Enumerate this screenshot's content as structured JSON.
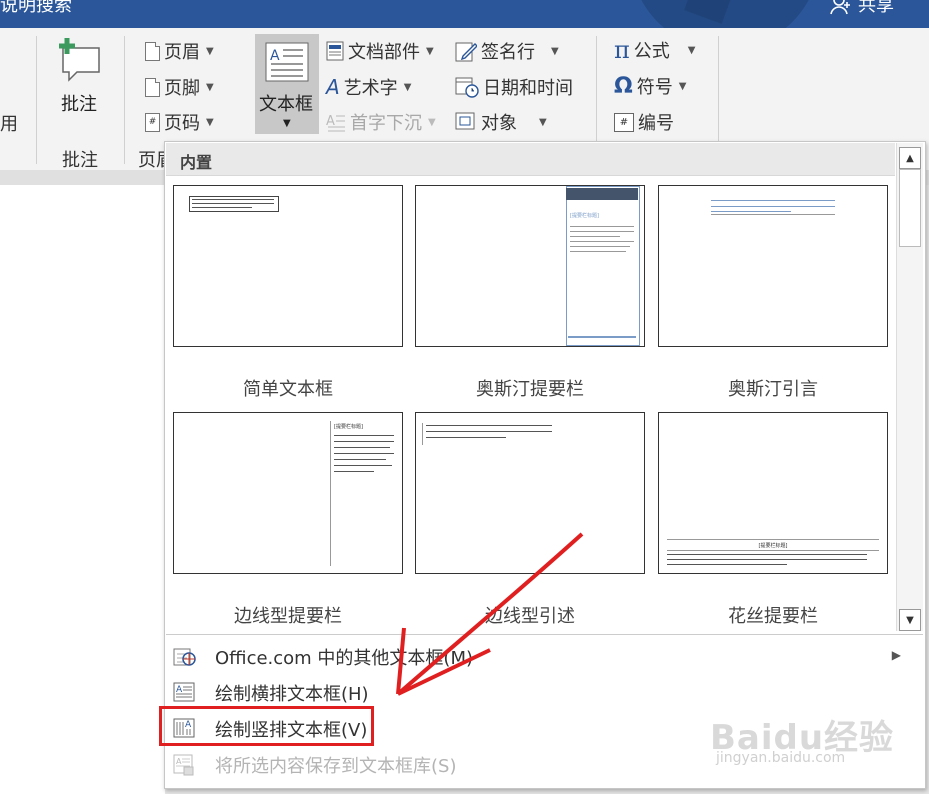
{
  "title_bar": {
    "search_text": "说明搜索",
    "share_label": "共享"
  },
  "ribbon": {
    "partial_left_label": "用",
    "comment_group": {
      "button_label": "批注",
      "group_label": "批注"
    },
    "header_footer_group": {
      "items": [
        {
          "label": "页眉",
          "icon": "header-icon"
        },
        {
          "label": "页脚",
          "icon": "footer-icon"
        },
        {
          "label": "页码",
          "icon": "page-number-icon"
        }
      ],
      "group_label_partial": "页眉"
    },
    "text_group": {
      "textbox_label": "文本框",
      "items": [
        {
          "label": "文档部件",
          "icon": "quick-parts-icon",
          "disabled": false
        },
        {
          "label": "艺术字",
          "icon": "wordart-icon",
          "disabled": false
        },
        {
          "label": "首字下沉",
          "icon": "drop-cap-icon",
          "disabled": true
        },
        {
          "label": "签名行",
          "icon": "signature-line-icon",
          "disabled": false
        },
        {
          "label": "日期和时间",
          "icon": "date-time-icon",
          "disabled": false
        },
        {
          "label": "对象",
          "icon": "object-icon",
          "disabled": false
        }
      ]
    },
    "symbols_group": {
      "items": [
        {
          "label": "公式",
          "icon": "pi-icon"
        },
        {
          "label": "符号",
          "icon": "omega-icon"
        },
        {
          "label": "编号",
          "icon": "number-icon"
        }
      ]
    }
  },
  "textbox_panel": {
    "section_title": "内置",
    "gallery": [
      {
        "label": "简单文本框"
      },
      {
        "label": "奥斯汀提要栏"
      },
      {
        "label": "奥斯汀引言"
      },
      {
        "label": "边线型提要栏"
      },
      {
        "label": "边线型引述"
      },
      {
        "label": "花丝提要栏"
      }
    ],
    "thumb_texts": {
      "sidebar_title": "[提要栏标题]",
      "austin_sidebar_title": "[提要栏标题]",
      "filigree_title": "[提要栏标题]"
    },
    "menu": [
      {
        "label": "Office.com 中的其他文本框(M)",
        "icon": "office-com-icon",
        "has_submenu": true,
        "disabled": false
      },
      {
        "label": "绘制横排文本框(H)",
        "icon": "horizontal-textbox-icon",
        "has_submenu": false,
        "disabled": false
      },
      {
        "label": "绘制竖排文本框(V)",
        "icon": "vertical-textbox-icon",
        "has_submenu": false,
        "disabled": false
      },
      {
        "label": "将所选内容保存到文本框库(S)",
        "icon": "save-selection-icon",
        "has_submenu": false,
        "disabled": true
      }
    ]
  },
  "watermark": {
    "brand": "Baidu经验",
    "url": "jingyan.baidu.com"
  },
  "annotation_color": "#e02020",
  "accent_color": "#2b579a"
}
